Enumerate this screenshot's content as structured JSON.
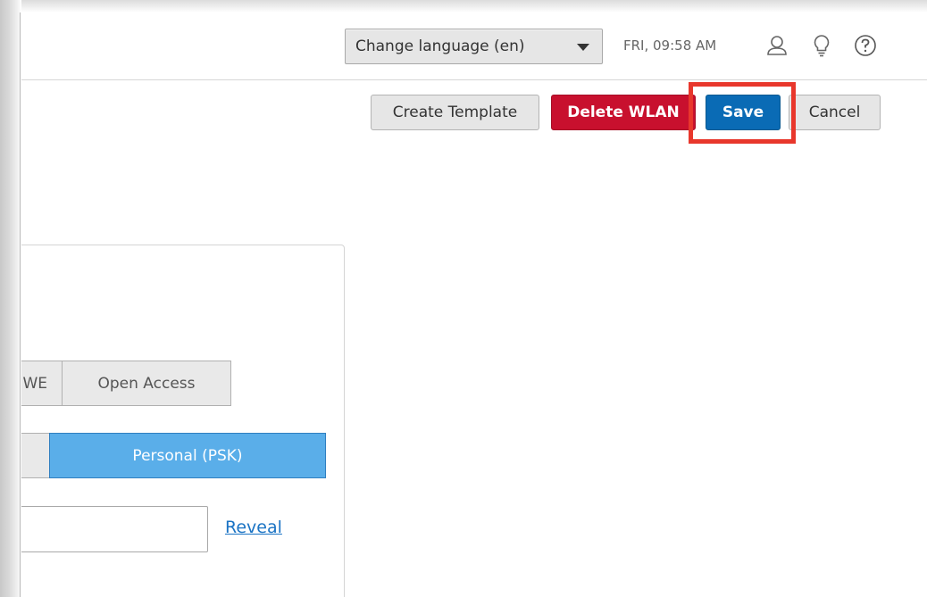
{
  "header": {
    "language_select": "Change language (en)",
    "clock": "FRI, 09:58 AM",
    "icons": [
      "user-icon",
      "lightbulb-icon",
      "help-icon"
    ]
  },
  "toolbar": {
    "create_template": "Create Template",
    "delete_wlan": "Delete WLAN",
    "save": "Save",
    "cancel": "Cancel"
  },
  "security": {
    "type_options": [
      "WE",
      "Open Access"
    ],
    "mode_options": [
      "",
      "Personal (PSK)"
    ],
    "selected_mode": "Personal (PSK)",
    "passphrase_value": "",
    "reveal_label": "Reveal"
  },
  "colors": {
    "save_blue": "#0a6bb5",
    "delete_red": "#c8102e",
    "selected_seg_blue": "#5aaee9",
    "highlight_red": "#e8372c",
    "link_blue": "#1a73c4"
  }
}
